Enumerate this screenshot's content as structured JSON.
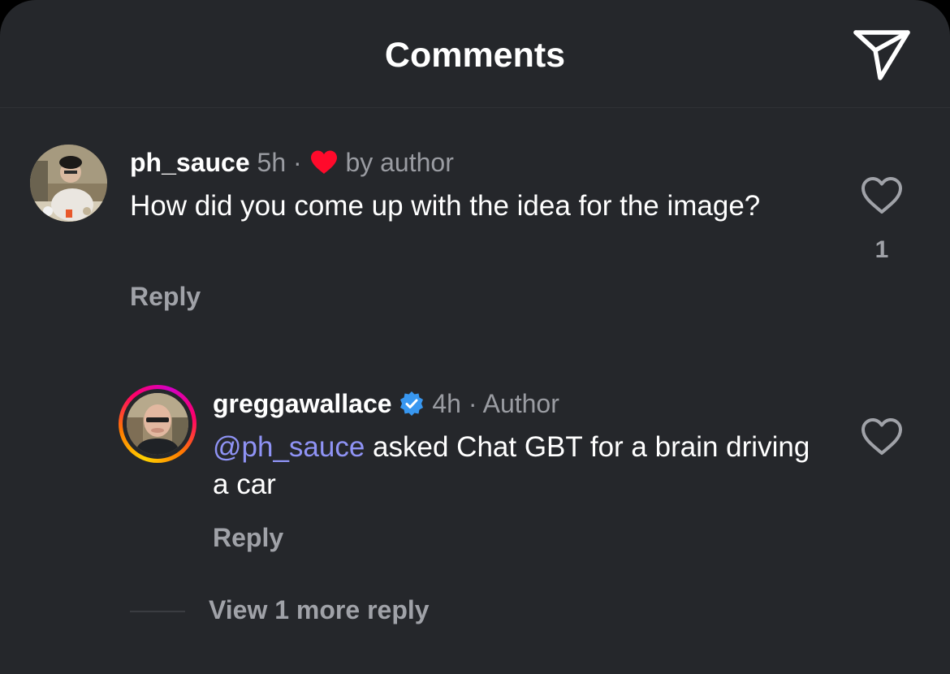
{
  "header": {
    "title": "Comments",
    "share_icon": "send-icon"
  },
  "comments": [
    {
      "username": "ph_sauce",
      "time": "5h",
      "separator": "·",
      "liked_by_author_icon": "heart-filled-icon",
      "liked_by_author_text": "by author",
      "text": "How did you come up with the idea for the image?",
      "reply_label": "Reply",
      "like_icon": "heart-outline-icon",
      "like_count": "1"
    }
  ],
  "replies": [
    {
      "username": "greggawallace",
      "verified_icon": "verified-badge-icon",
      "time": "4h",
      "separator": "·",
      "role": "Author",
      "mention": "@ph_sauce",
      "text": " asked Chat GBT for a brain driving a car",
      "reply_label": "Reply",
      "like_icon": "heart-outline-icon"
    }
  ],
  "view_more_label": "View 1 more reply",
  "colors": {
    "background": "#25272b",
    "text_primary": "#ffffff",
    "text_secondary": "#9a9ca2",
    "mention": "#8f93f5",
    "heart_red": "#ff0a2b",
    "verified_blue": "#3897f0"
  }
}
